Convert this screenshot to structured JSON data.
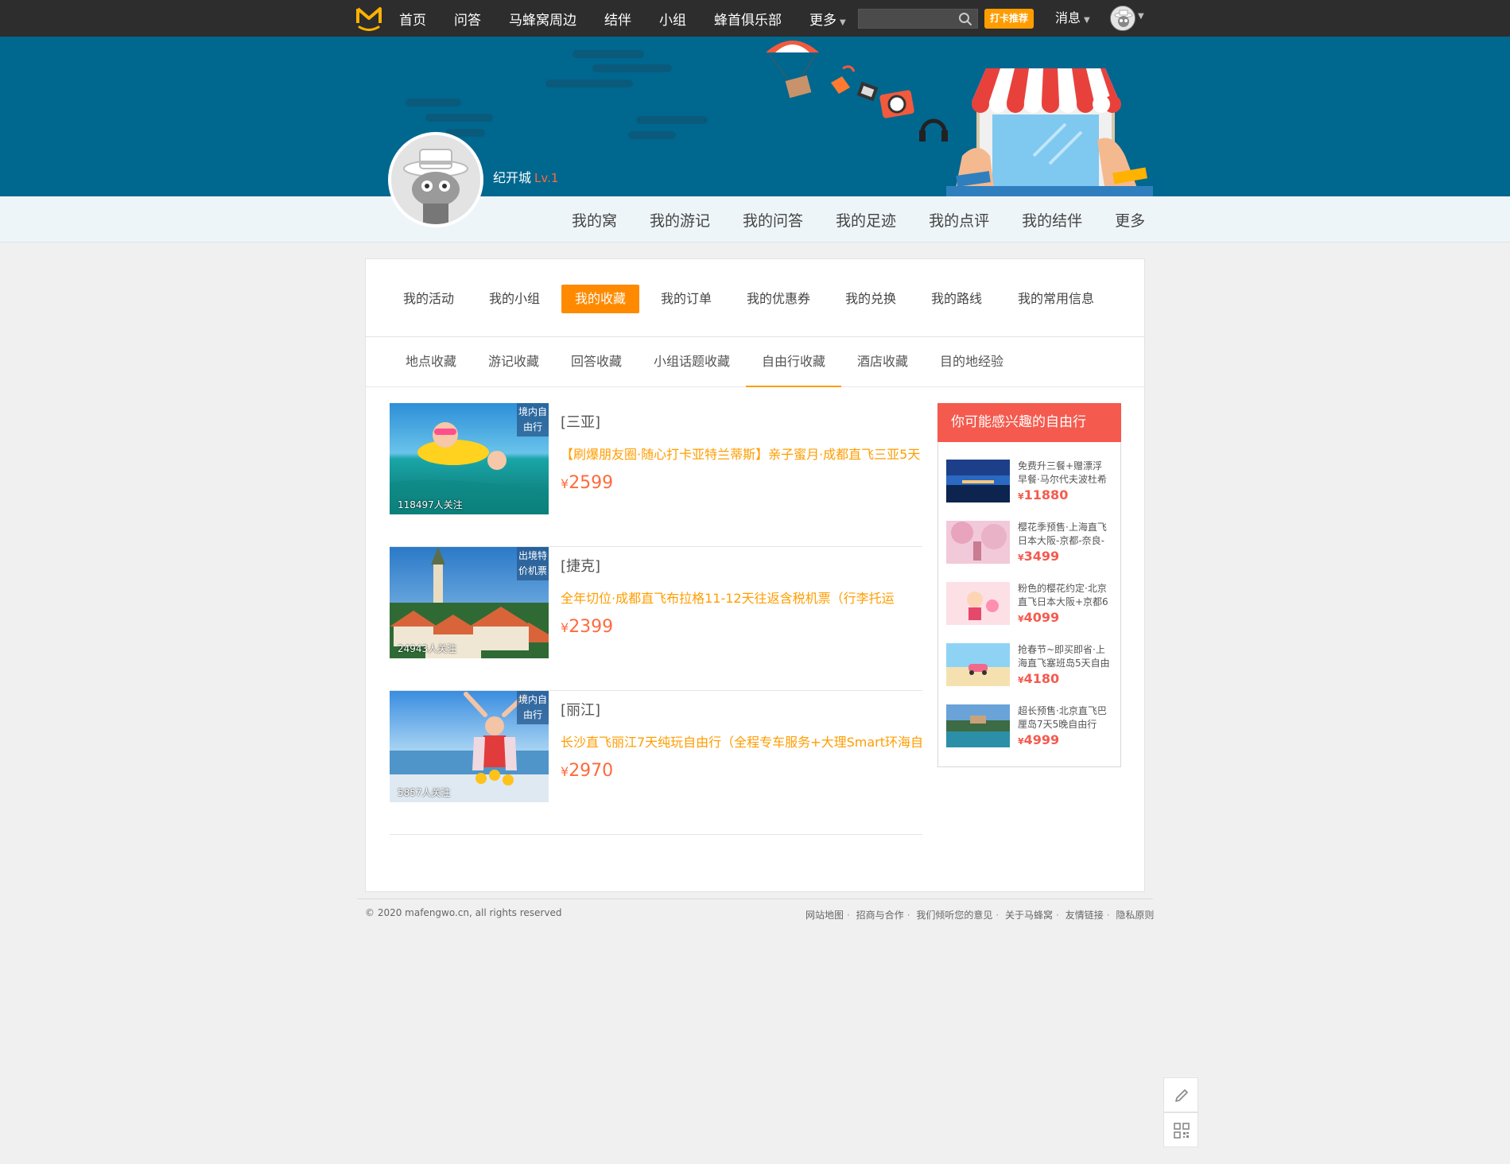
{
  "topnav": {
    "items": [
      "首页",
      "问答",
      "马蜂窝周边",
      "结伴",
      "小组",
      "蜂首俱乐部",
      "更多"
    ],
    "search_placeholder": "",
    "checkin_label": "打卡推荐",
    "messages_label": "消息"
  },
  "profile": {
    "name": "纪开城",
    "level": "Lv.1"
  },
  "subnav": {
    "tabs": [
      "我的窝",
      "我的游记",
      "我的问答",
      "我的足迹",
      "我的点评",
      "我的结伴",
      "更多"
    ]
  },
  "primary_tabs": {
    "items": [
      "我的活动",
      "我的小组",
      "我的收藏",
      "我的订单",
      "我的优惠券",
      "我的兑换",
      "我的路线",
      "我的常用信息"
    ],
    "active": "我的收藏"
  },
  "secondary_tabs": {
    "items": [
      "地点收藏",
      "游记收藏",
      "回答收藏",
      "小组话题收藏",
      "自由行收藏",
      "酒店收藏",
      "目的地经验"
    ],
    "active": "自由行收藏"
  },
  "favorites": [
    {
      "tag": "境内自由行",
      "follow": "118497人关注",
      "dest": "[三亚]",
      "title": "【刷爆朋友圈·随心打卡亚特兰蒂斯】亲子蜜月·成都直飞三亚5天",
      "currency": "¥",
      "price": "2599"
    },
    {
      "tag": "出境特价机票",
      "follow": "24943人关注",
      "dest": "[捷克]",
      "title": "全年切位·成都直飞布拉格11-12天往返含税机票（行李托运",
      "currency": "¥",
      "price": "2399"
    },
    {
      "tag": "境内自由行",
      "follow": "5857人关注",
      "dest": "[丽江]",
      "title": "长沙直飞丽江7天纯玩自由行（全程专车服务+大理Smart环海自",
      "currency": "¥",
      "price": "2970"
    }
  ],
  "sidebar": {
    "title": "你可能感兴趣的自由行",
    "items": [
      {
        "title": "免费升三餐+赠漂浮早餐·马尔代夫波杜希蒂",
        "currency": "¥",
        "price": "11880"
      },
      {
        "title": "樱花季预售·上海直飞日本大阪-京都-奈良-",
        "currency": "¥",
        "price": "3499"
      },
      {
        "title": "粉色的樱花约定·北京直飞日本大阪+京都6",
        "currency": "¥",
        "price": "4099"
      },
      {
        "title": "抢春节~即买即省·上海直飞塞班岛5天自由",
        "currency": "¥",
        "price": "4180"
      },
      {
        "title": "超长预售·北京直飞巴厘岛7天5晚自由行",
        "currency": "¥",
        "price": "4999"
      }
    ]
  },
  "footer": {
    "copyright": "© 2020 mafengwo.cn, all rights reserved",
    "links": [
      "网站地图",
      "招商与合作",
      "我们倾听您的意见",
      "关于马蜂窝",
      "友情链接",
      "隐私原则"
    ]
  },
  "colors": {
    "topbar": "#2d2d2d",
    "banner": "#00678f",
    "accent_orange": "#ff8a00",
    "price": "#ff6a3d",
    "sidebar_head": "#f55a4e"
  },
  "icons": [
    "logo-icon",
    "search-icon",
    "caret-down-icon",
    "edit-icon",
    "qrcode-icon"
  ]
}
